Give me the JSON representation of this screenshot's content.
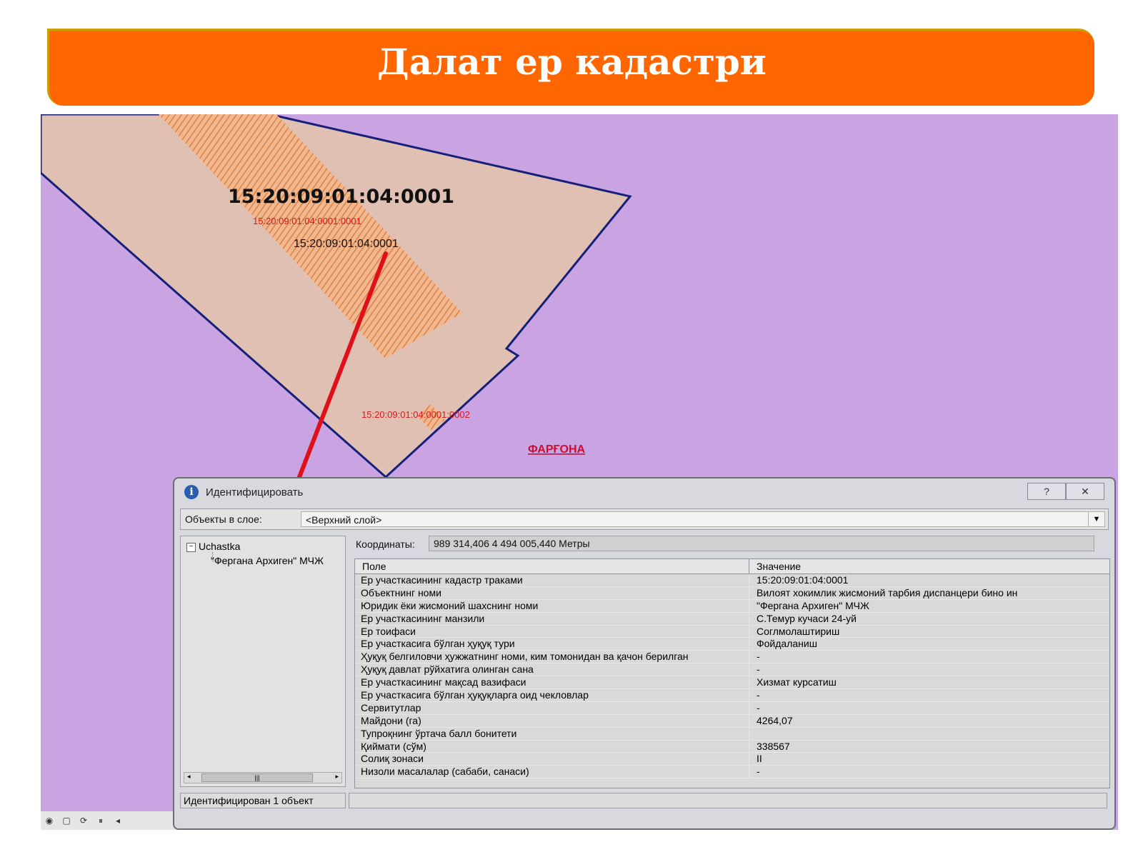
{
  "banner": {
    "title": "Далат ер кадастри"
  },
  "map": {
    "parcel_main_label": "15:20:09:01:04:0001",
    "sub_label_1": "15:20:09:01:04:0001:0001",
    "parcel_label_2": "15:20:09:01:04:0001",
    "sub_label_2": "15:20:09:01:04:0001:0002",
    "region_label": "ФАРҒОНА"
  },
  "dialog": {
    "title": "Идентифицировать",
    "help_btn": "?",
    "close_btn": "✕",
    "layer_label": "Объекты в слое:",
    "layer_value": "<Верхний слой>",
    "tree": {
      "root": "Uchastka",
      "child": "\"Фергана Архиген\" МЧЖ"
    },
    "coords_label": "Координаты:",
    "coords_value": "989 314,406  4 494 005,440 Метры",
    "columns": [
      "Поле",
      "Значение"
    ],
    "rows": [
      {
        "field": "Ер участкасининг кадастр траками",
        "value": "15:20:09:01:04:0001"
      },
      {
        "field": "Объектнинг номи",
        "value": "Вилоят хокимлик жисмоний тарбия диспанцери бино ин"
      },
      {
        "field": "Юридик ёки жисмоний шахснинг номи",
        "value": "\"Фергана Архиген\" МЧЖ"
      },
      {
        "field": "Ер участкасининг манзили",
        "value": "С.Темур кучаси 24-уй"
      },
      {
        "field": "Ер тоифаси",
        "value": "Соглмолаштириш"
      },
      {
        "field": "Ер участкасига бўлган ҳуқуқ тури",
        "value": "Фойдаланиш"
      },
      {
        "field": "Ҳуқуқ белгиловчи ҳужжатнинг номи, ким томонидан ва қачон берилган",
        "value": "-"
      },
      {
        "field": "Ҳуқуқ давлат рўйхатига олинган сана",
        "value": "-"
      },
      {
        "field": "Ер участкасининг мақсад вазифаси",
        "value": "Хизмат курсатиш"
      },
      {
        "field": "Ер участкасига бўлган ҳуқуқларга оид чекловлар",
        "value": "-"
      },
      {
        "field": "Сервитутлар",
        "value": "-"
      },
      {
        "field": "Майдони (га)",
        "value": "4264,07"
      },
      {
        "field": "Тупроқнинг ўртача балл бонитети",
        "value": ""
      },
      {
        "field": "Қиймати (сўм)",
        "value": "338567"
      },
      {
        "field": "Солиқ зонаси",
        "value": "II"
      },
      {
        "field": "Низоли масалалар (сабаби, санаси)",
        "value": "-"
      }
    ],
    "status": "Идентифицирован 1 объект"
  },
  "colors": {
    "banner": "#ff6600",
    "map_background": "#c9a3e2",
    "parcel_fill": "#dfc0b2",
    "hatch": "#e8905a",
    "boundary": "#16207a",
    "arrow": "#e0101a"
  },
  "icons": {
    "info": "info-icon",
    "toolbar": [
      "globe-icon",
      "page-icon",
      "refresh-icon",
      "pause-icon",
      "arrow-left-icon"
    ]
  }
}
